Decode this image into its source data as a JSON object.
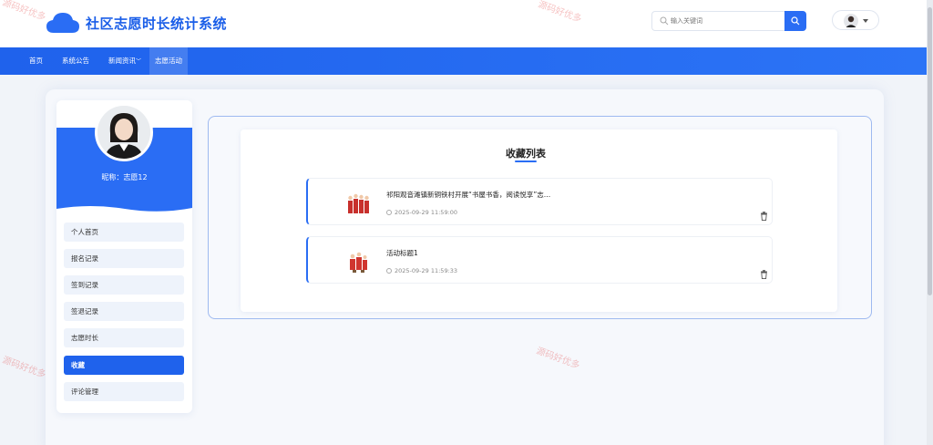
{
  "header": {
    "site_title": "社区志愿时长统计系统",
    "search_placeholder": "输入关键词"
  },
  "nav": {
    "items": [
      {
        "label": "首页"
      },
      {
        "label": "系统公告"
      },
      {
        "label": "新闻资讯"
      },
      {
        "label": "志愿活动"
      }
    ],
    "active_index": 3
  },
  "profile": {
    "nickname": "昵称：志愿12"
  },
  "sidebar": {
    "items": [
      {
        "label": "个人首页"
      },
      {
        "label": "报名记录"
      },
      {
        "label": "签到记录"
      },
      {
        "label": "签退记录"
      },
      {
        "label": "志愿时长"
      },
      {
        "label": "收藏"
      },
      {
        "label": "评论管理"
      }
    ],
    "active_index": 5
  },
  "main": {
    "title": "收藏列表",
    "favorites": [
      {
        "title": "祁阳观音滩镇新铜铁村开展“书屋书香，阅读悦享”志…",
        "time": "2025-09-29 11:59:00"
      },
      {
        "title": "活动标题1",
        "time": "2025-09-29 11:59:33"
      }
    ]
  },
  "watermark": {
    "text": "源码好优多"
  },
  "colors": {
    "primary": "#2a6df4",
    "title": "#1a5ee8",
    "border": "#9fbaf0"
  }
}
